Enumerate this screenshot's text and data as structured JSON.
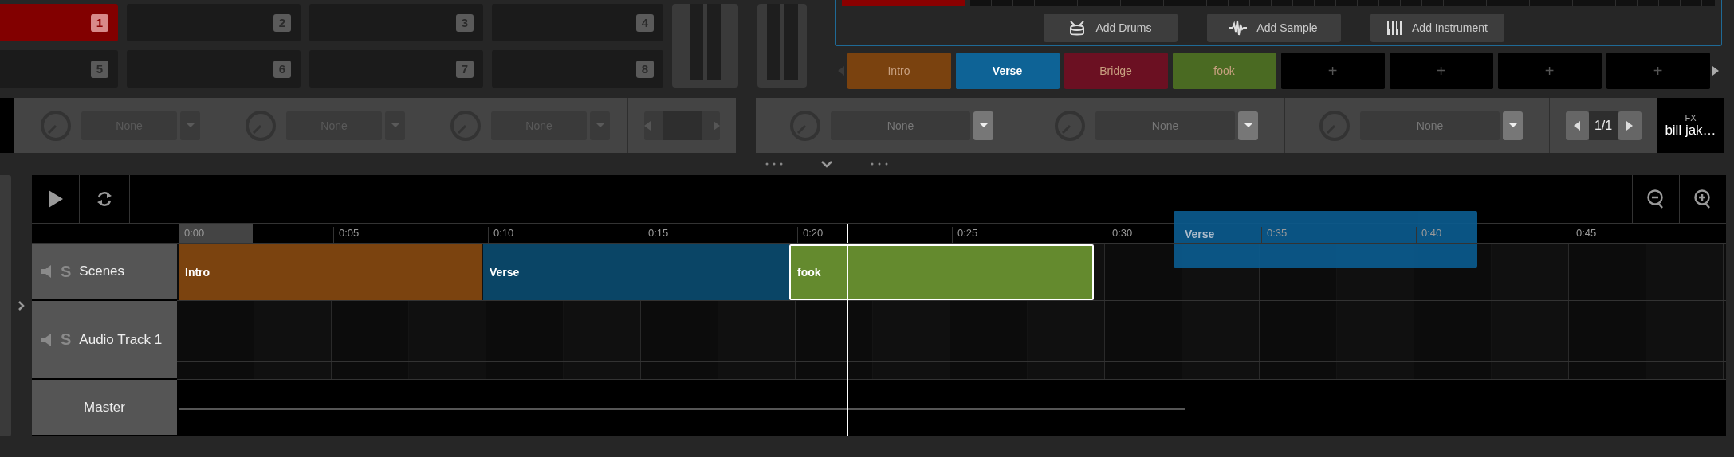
{
  "pads": [
    {
      "label": "1",
      "selected": true
    },
    {
      "label": "2",
      "selected": false
    },
    {
      "label": "3",
      "selected": false
    },
    {
      "label": "4",
      "selected": false
    },
    {
      "label": "5",
      "selected": false
    },
    {
      "label": "6",
      "selected": false
    },
    {
      "label": "7",
      "selected": false
    },
    {
      "label": "8",
      "selected": false
    }
  ],
  "add_buttons": [
    {
      "label": "Add Drums",
      "kind": "drums"
    },
    {
      "label": "Add Sample",
      "kind": "sample"
    },
    {
      "label": "Add Instrument",
      "kind": "instrument"
    }
  ],
  "scene_slots": [
    {
      "kind": "scene",
      "label": "Intro",
      "color": "#7a420f",
      "selected": false
    },
    {
      "kind": "scene",
      "label": "Verse",
      "color": "#0e6396",
      "selected": true
    },
    {
      "kind": "scene",
      "label": "Bridge",
      "color": "#6b1022",
      "selected": false
    },
    {
      "kind": "scene",
      "label": "fook",
      "color": "#4a6a22",
      "selected": false
    },
    {
      "kind": "empty",
      "label": "+",
      "selected": false
    },
    {
      "kind": "empty",
      "label": "+",
      "selected": false
    },
    {
      "kind": "empty",
      "label": "+",
      "selected": false
    },
    {
      "kind": "empty",
      "label": "+",
      "selected": false
    }
  ],
  "left_devices": [
    {
      "value": "None"
    },
    {
      "value": "None"
    },
    {
      "value": "None"
    }
  ],
  "right_devices": [
    {
      "value": "None"
    },
    {
      "value": "None"
    },
    {
      "value": "None"
    }
  ],
  "pager": {
    "text": "1/1"
  },
  "fx": {
    "label": "FX",
    "name": "bill jak…"
  },
  "timeline": {
    "ruler": [
      "0:00",
      "0:05",
      "0:10",
      "0:15",
      "0:20",
      "0:25",
      "0:30",
      "0:35",
      "0:40",
      "0:45"
    ],
    "tracks": [
      {
        "kind": "scenes",
        "name": "Scenes",
        "solo": "S"
      },
      {
        "kind": "audio",
        "name": "Audio Track 1",
        "solo": "S"
      },
      {
        "kind": "master",
        "name": "Master"
      }
    ],
    "clips": [
      {
        "label": "Intro",
        "color": "#7b430f",
        "selected": false
      },
      {
        "label": "Verse",
        "color": "#0a4566",
        "selected": false
      },
      {
        "label": "fook",
        "color": "#648a2e",
        "selected": true
      }
    ],
    "drag_clip": {
      "label": "Verse",
      "color": "#0b5b8e"
    }
  }
}
